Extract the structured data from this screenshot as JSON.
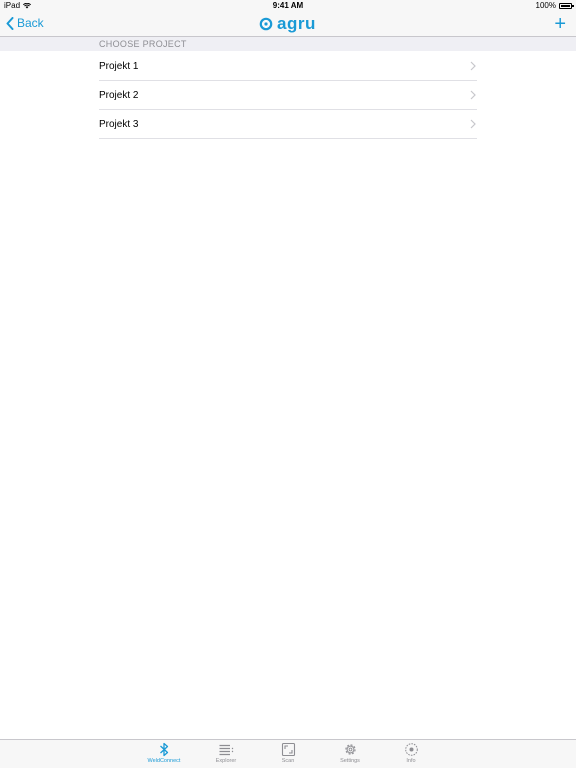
{
  "status_bar": {
    "device": "iPad",
    "time": "9:41 AM",
    "battery": "100%"
  },
  "navbar": {
    "back_label": "Back",
    "logo_text": "agru",
    "add_label": "+"
  },
  "section": {
    "title": "CHOOSE PROJECT"
  },
  "projects": [
    {
      "label": "Projekt 1"
    },
    {
      "label": "Projekt 2"
    },
    {
      "label": "Projekt 3"
    }
  ],
  "tabs": [
    {
      "label": "WeldConnect",
      "icon": "bluetooth-icon",
      "active": true
    },
    {
      "label": "Explorer",
      "icon": "list-icon",
      "active": false
    },
    {
      "label": "Scan",
      "icon": "scan-icon",
      "active": false
    },
    {
      "label": "Settings",
      "icon": "gear-icon",
      "active": false
    },
    {
      "label": "Info",
      "icon": "info-icon",
      "active": false
    }
  ],
  "colors": {
    "accent": "#1a9ad6",
    "inactive": "#8e8e93",
    "section_bg": "#efeff4",
    "bar_bg": "#f7f7f7"
  }
}
